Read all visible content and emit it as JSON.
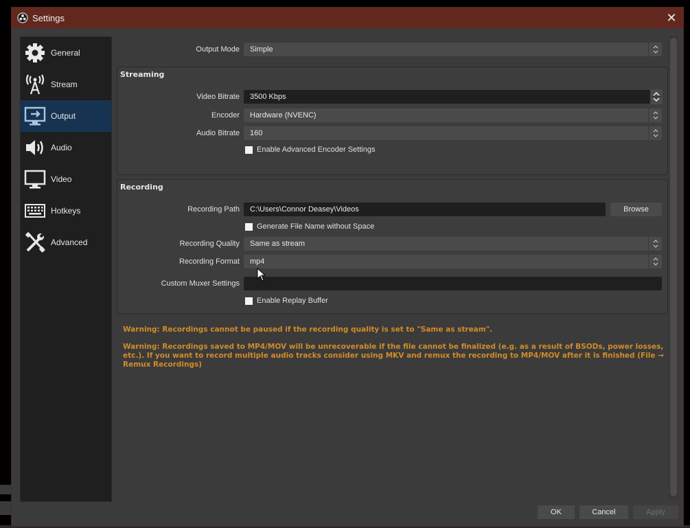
{
  "window": {
    "title": "Settings",
    "close_label": "✕"
  },
  "sidebar": {
    "items": [
      {
        "label": "General",
        "icon": "gear-icon",
        "active": false
      },
      {
        "label": "Stream",
        "icon": "antenna-icon",
        "active": false
      },
      {
        "label": "Output",
        "icon": "monitor-arrow-icon",
        "active": true
      },
      {
        "label": "Audio",
        "icon": "speaker-icon",
        "active": false
      },
      {
        "label": "Video",
        "icon": "monitor-icon",
        "active": false
      },
      {
        "label": "Hotkeys",
        "icon": "keyboard-icon",
        "active": false
      },
      {
        "label": "Advanced",
        "icon": "wrench-screwdriver-icon",
        "active": false
      }
    ]
  },
  "output_mode": {
    "label": "Output Mode",
    "value": "Simple"
  },
  "streaming": {
    "title": "Streaming",
    "video_bitrate": {
      "label": "Video Bitrate",
      "value": "3500 Kbps"
    },
    "encoder": {
      "label": "Encoder",
      "value": "Hardware (NVENC)"
    },
    "audio_bitrate": {
      "label": "Audio Bitrate",
      "value": "160"
    },
    "advanced_encoder": {
      "label": "Enable Advanced Encoder Settings",
      "checked": false
    }
  },
  "recording": {
    "title": "Recording",
    "path": {
      "label": "Recording Path",
      "value": "C:\\Users\\Connor Deasey\\Videos",
      "browse_label": "Browse"
    },
    "no_space": {
      "label": "Generate File Name without Space",
      "checked": false
    },
    "quality": {
      "label": "Recording Quality",
      "value": "Same as stream"
    },
    "format": {
      "label": "Recording Format",
      "value": "mp4"
    },
    "muxer": {
      "label": "Custom Muxer Settings",
      "value": ""
    },
    "replay_buffer": {
      "label": "Enable Replay Buffer",
      "checked": false
    }
  },
  "warnings": [
    "Warning: Recordings cannot be paused if the recording quality is set to \"Same as stream\".",
    "Warning: Recordings saved to MP4/MOV will be unrecoverable if the file cannot be finalized (e.g. as a result of BSODs, power losses, etc.). If you want to record multiple audio tracks consider using MKV and remux the recording to MP4/MOV after it is finished (File → Remux Recordings)"
  ],
  "footer": {
    "ok_label": "OK",
    "cancel_label": "Cancel",
    "apply_label": "Apply"
  },
  "colors": {
    "titlebar": "#62271d",
    "active_item": "#163352",
    "warning": "#d28b2a"
  }
}
